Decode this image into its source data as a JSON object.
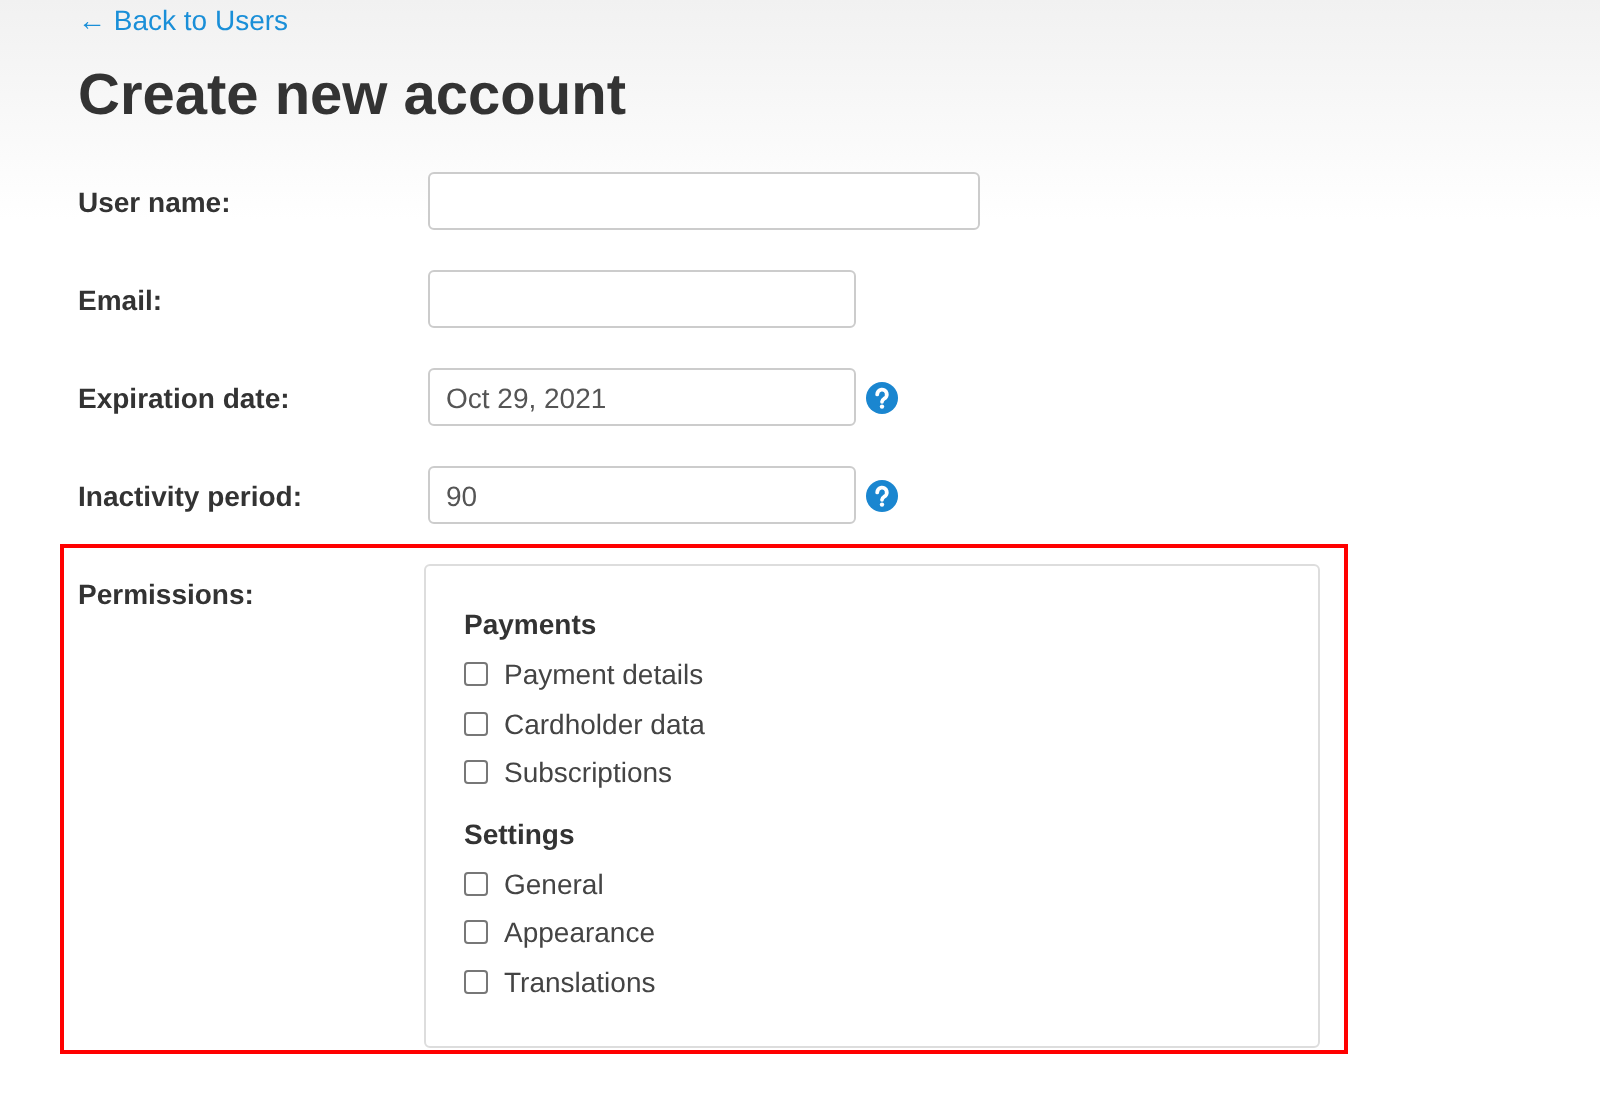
{
  "back_link": "← Back to Users",
  "title": "Create new account",
  "fields": [
    {
      "label": "User name:",
      "help": false
    },
    {
      "label": "Email:",
      "help": false
    },
    {
      "label": "Expiration date:",
      "value": "Oct 29, 2021",
      "help": true
    },
    {
      "label": "Inactivity period:",
      "value": "90",
      "help": true
    }
  ],
  "permissions": {
    "label": "Permissions:",
    "highlighted": true,
    "groups": [
      {
        "title": "Payments",
        "items": [
          {
            "label": "Payment details",
            "checked": false
          },
          {
            "label": "Cardholder data",
            "checked": false
          },
          {
            "label": "Subscriptions",
            "checked": false
          }
        ]
      },
      {
        "title": "Settings",
        "items": [
          {
            "label": "General",
            "checked": false
          },
          {
            "label": "Appearance",
            "checked": false
          },
          {
            "label": "Translations",
            "checked": false
          }
        ]
      }
    ]
  }
}
